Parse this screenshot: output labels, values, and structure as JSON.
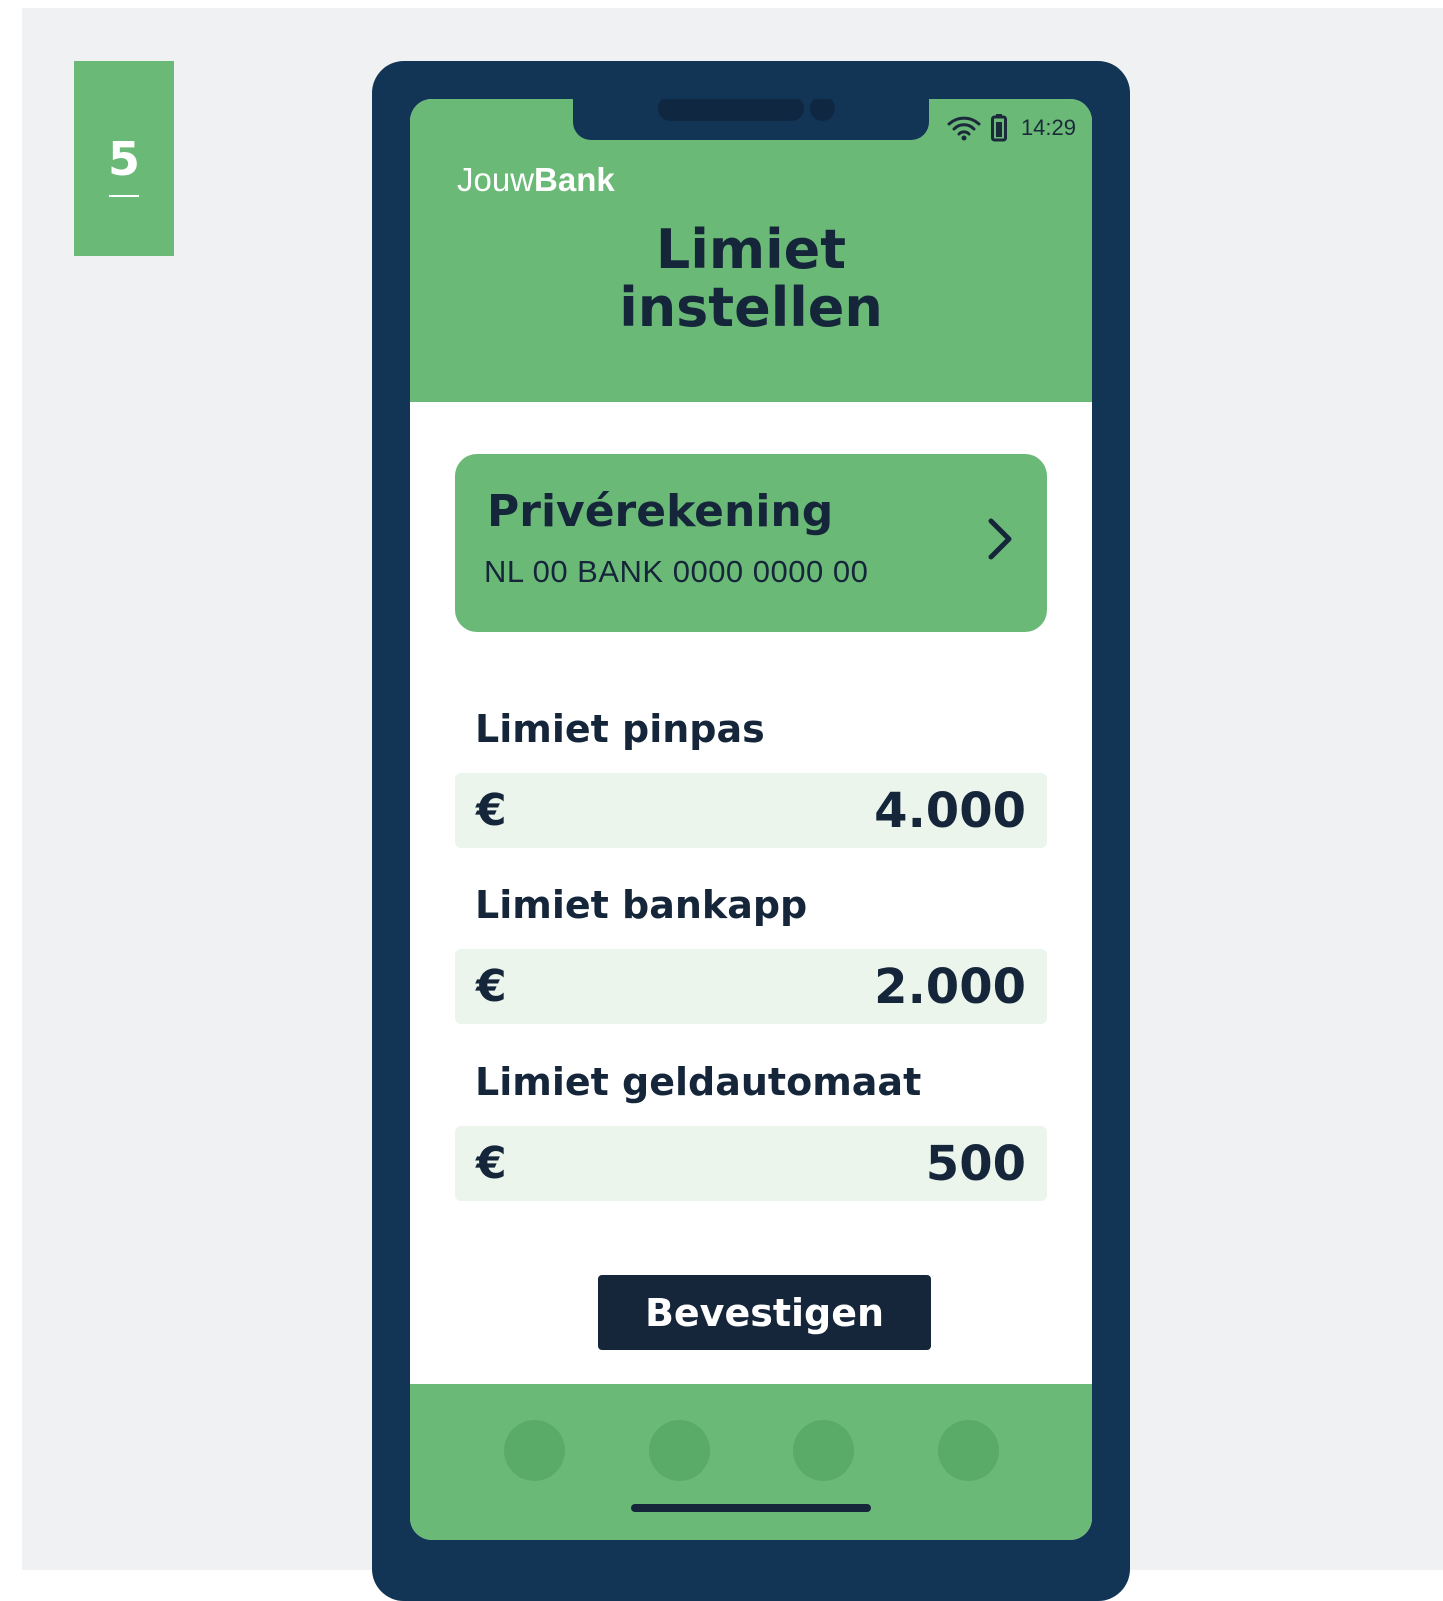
{
  "step": {
    "number": "5"
  },
  "status_bar": {
    "time": "14:29",
    "icons": [
      "wifi-icon",
      "battery-icon"
    ]
  },
  "brand": {
    "prefix": "Jouw",
    "suffix": "Bank"
  },
  "page": {
    "title_line1": "Limiet",
    "title_line2": "instellen"
  },
  "account": {
    "name": "Privérekening",
    "iban": "NL 00 BANK 0000 0000 00",
    "icon": "chevron-right-icon"
  },
  "limits": [
    {
      "label": "Limiet pinpas",
      "currency": "€",
      "amount": "4.000"
    },
    {
      "label": "Limiet bankapp",
      "currency": "€",
      "amount": "2.000"
    },
    {
      "label": "Limiet geldautomaat",
      "currency": "€",
      "amount": "500"
    }
  ],
  "actions": {
    "confirm_label": "Bevestigen"
  },
  "colors": {
    "brand_green": "#6bb977",
    "phone_frame": "#133555",
    "text_dark": "#16263a",
    "field_bg": "#ebf5ec",
    "background": "#f0f1f3"
  }
}
